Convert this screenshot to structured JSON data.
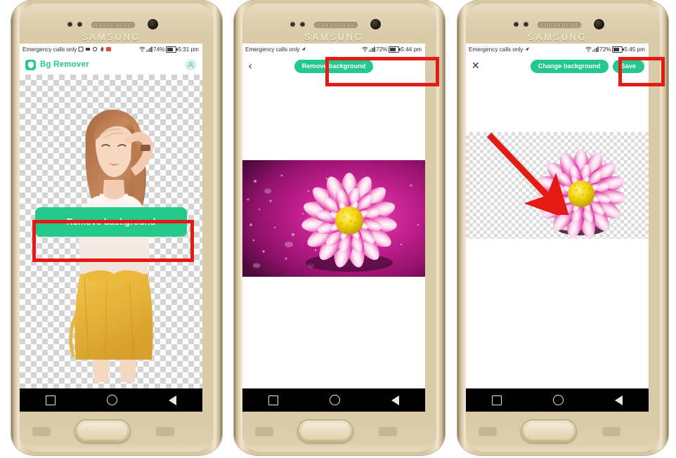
{
  "meta": {
    "description": "Three-panel Android tutorial screenshot of the Bg Remover app on a gold Samsung phone",
    "accent_green": "#23c88b",
    "annotation_red": "#e31b14",
    "nav_bar_color": "#000000",
    "screen_background": "#ffffff"
  },
  "phones": [
    {
      "device_brand": "SAMSUNG",
      "status_bar": {
        "carrier": "Emergency calls only",
        "icons": [
          "screenshot-icon",
          "sim-icon",
          "sync-icon",
          "bluetooth-icon",
          "alert-icon"
        ],
        "wifi": "wifi-icon",
        "signal": "signal-icon",
        "battery_percent": "74%",
        "battery": "battery-icon",
        "time": "5:31 pm"
      },
      "app_bar": {
        "logo": "shield-logo-icon",
        "title": "Bg Remover",
        "avatar": "account-icon"
      },
      "canvas": {
        "type": "checkerboard-transparency",
        "subject": "woman-portrait-cutout"
      },
      "primary_button": "Remove background",
      "nav_bar": [
        "recents-square-icon",
        "home-circle-icon",
        "back-triangle-icon"
      ]
    },
    {
      "device_brand": "SAMSUNG",
      "status_bar": {
        "carrier": "Emergency calls only",
        "icons": [
          "location-icon"
        ],
        "wifi": "wifi-icon",
        "signal": "signal-icon",
        "battery_percent": "72%",
        "battery": "battery-icon",
        "time": "5:44 pm"
      },
      "app_bar": {
        "back": "chevron-left-icon",
        "action": "Remove background"
      },
      "canvas": {
        "type": "photo",
        "subject": "pink-chrysanthemum-on-purple-water-drops"
      },
      "nav_bar": [
        "recents-square-icon",
        "home-circle-icon",
        "back-triangle-icon"
      ]
    },
    {
      "device_brand": "SAMSUNG",
      "status_bar": {
        "carrier": "Emergency calls only",
        "icons": [
          "location-icon"
        ],
        "wifi": "wifi-icon",
        "signal": "signal-icon",
        "battery_percent": "72%",
        "battery": "battery-icon",
        "time": "5:45 pm"
      },
      "app_bar": {
        "close": "close-x-icon",
        "action": "Change background",
        "save": "Save"
      },
      "canvas": {
        "type": "checkerboard-transparency",
        "subject": "pink-chrysanthemum-cutout"
      },
      "nav_bar": [
        "recents-square-icon",
        "home-circle-icon",
        "back-triangle-icon"
      ]
    }
  ],
  "annotations": [
    {
      "kind": "rectangle",
      "target": "Remove background",
      "panel": 1
    },
    {
      "kind": "rectangle",
      "target": "Remove background",
      "panel": 2
    },
    {
      "kind": "rectangle",
      "target": "Save",
      "panel": 3
    },
    {
      "kind": "arrow",
      "target": "pink-chrysanthemum-cutout",
      "panel": 3
    }
  ]
}
